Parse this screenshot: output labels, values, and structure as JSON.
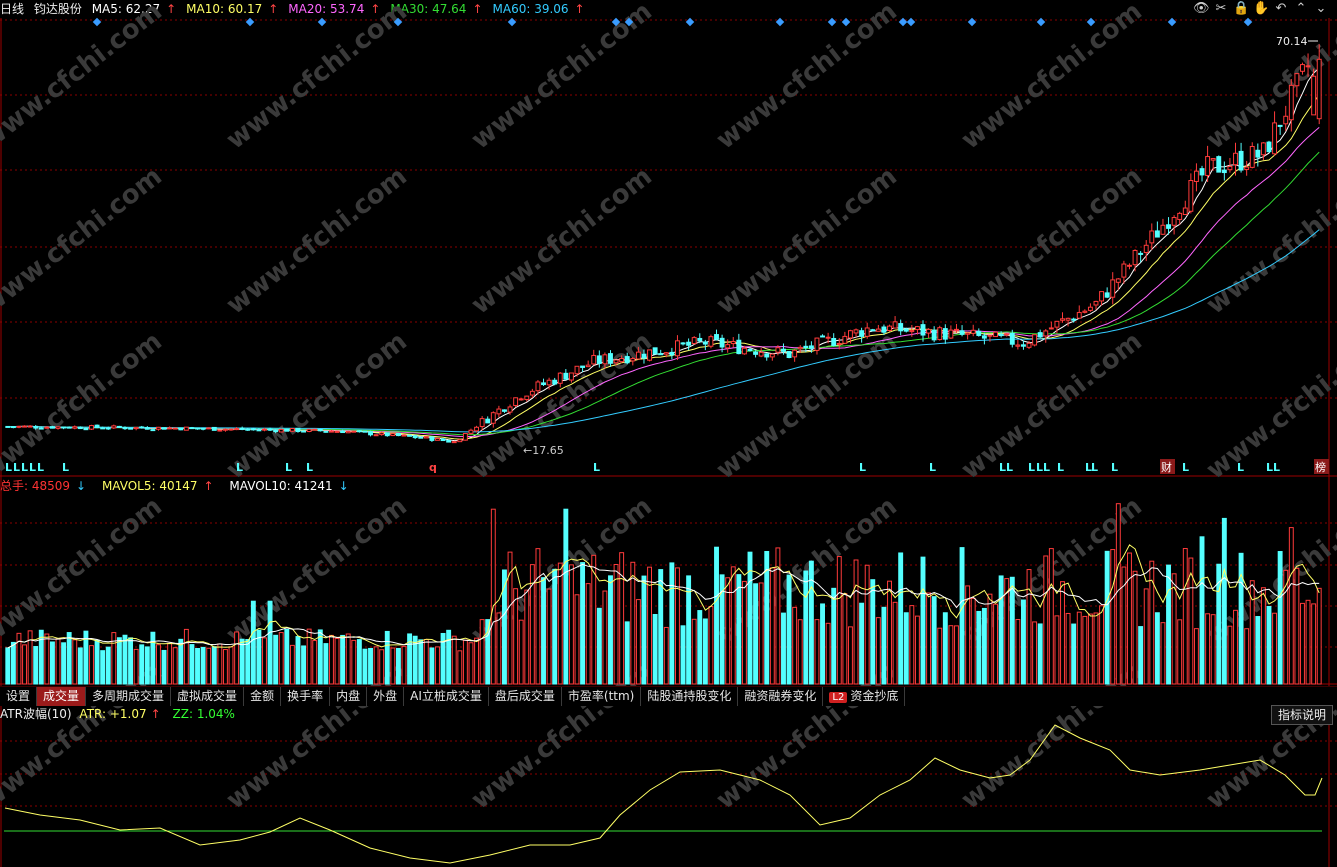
{
  "header": {
    "period": "日线",
    "stock_name": "钧达股份",
    "ma": [
      {
        "label": "MA5: 62.27",
        "arrow": "↑",
        "color": "#ffffff"
      },
      {
        "label": "MA10: 60.17",
        "arrow": "↑",
        "color": "#ffff66"
      },
      {
        "label": "MA20: 53.74",
        "arrow": "↑",
        "color": "#ff66ff"
      },
      {
        "label": "MA30: 47.64",
        "arrow": "↑",
        "color": "#33dd33"
      },
      {
        "label": "MA60: 39.06",
        "arrow": "↑",
        "color": "#33ccff"
      }
    ],
    "arrow_color": "#ff4444"
  },
  "toolbar": {
    "icons": [
      "eye-icon",
      "scissors-icon",
      "lock-icon",
      "hand-icon",
      "undo-icon",
      "chevron-up-icon",
      "chevron-down-icon"
    ]
  },
  "price_panel": {
    "high_label": "70.14",
    "low_label": "17.65",
    "signal_letters": [
      "L",
      "q",
      "财",
      "榜"
    ],
    "colors": {
      "up": "#ff3b3b",
      "down": "#54ffff",
      "grid": "#8a0000",
      "diamond": "#3a9cff"
    }
  },
  "volume_legend": {
    "total": {
      "label": "总手: 48509",
      "arrow": "↓",
      "color": "#ff3333"
    },
    "mavol5": {
      "label": "MAVOL5: 40147",
      "arrow": "↑",
      "color": "#ffff66"
    },
    "mavol10": {
      "label": "MAVOL10: 41241",
      "arrow": "↓",
      "color": "#ffffff"
    }
  },
  "tabs": [
    {
      "label": "设置"
    },
    {
      "label": "成交量",
      "active": true
    },
    {
      "label": "多周期成交量"
    },
    {
      "label": "虚拟成交量"
    },
    {
      "label": "金额"
    },
    {
      "label": "换手率"
    },
    {
      "label": "内盘"
    },
    {
      "label": "外盘"
    },
    {
      "label": "AI立桩成交量"
    },
    {
      "label": "盘后成交量"
    },
    {
      "label": "市盈率(ttm)"
    },
    {
      "label": "陆股通持股变化"
    },
    {
      "label": "融资融券变化"
    },
    {
      "label": "资金抄底",
      "badge": "L2"
    }
  ],
  "atr_legend": {
    "name": "ATR波幅(10)",
    "atr": {
      "label": "ATR: +1.07",
      "arrow": "↑",
      "color": "#ffff66"
    },
    "zz": {
      "label": "ZZ: 1.04%",
      "color": "#33ff33"
    }
  },
  "explain_button": "指标说明",
  "watermark": "www.cfchi.com",
  "chart_data": {
    "type": "candlestick",
    "title": "钧达股份 日线",
    "price_high": 70.14,
    "price_low": 17.65,
    "close_trend": [
      [
        0,
        20.6
      ],
      [
        30,
        20.4
      ],
      [
        60,
        20.0
      ],
      [
        75,
        19.1
      ],
      [
        80,
        18.6
      ],
      [
        92,
        24.8
      ],
      [
        105,
        29.0
      ],
      [
        125,
        31.5
      ],
      [
        140,
        30.0
      ],
      [
        155,
        33.5
      ],
      [
        170,
        32.5
      ],
      [
        182,
        31.5
      ],
      [
        195,
        36.5
      ],
      [
        205,
        45.0
      ],
      [
        215,
        54.0
      ],
      [
        225,
        56.0
      ],
      [
        235,
        70.14
      ]
    ],
    "ma_last": {
      "MA5": 62.27,
      "MA10": 60.17,
      "MA20": 53.74,
      "MA30": 47.64,
      "MA60": 39.06
    },
    "volume_last": 48509,
    "mavol5": 40147,
    "mavol10": 41241,
    "atr": 1.07,
    "zz_percent": 1.04
  }
}
